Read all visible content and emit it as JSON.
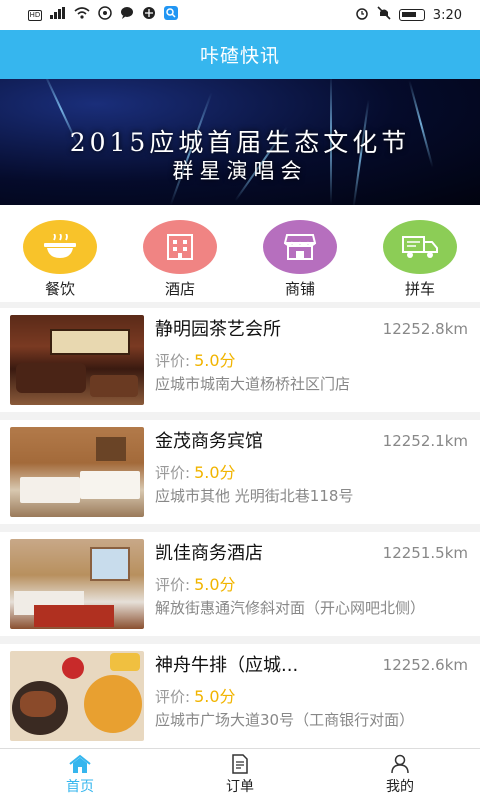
{
  "status": {
    "carrier": "HD",
    "signal": "4G",
    "time": "3:20"
  },
  "header": {
    "title": "咔碴快讯"
  },
  "banner": {
    "title": "2015应城首届生态文化节",
    "subtitle": "群星演唱会"
  },
  "categories": [
    {
      "label": "餐饮",
      "color": "#f8c32a",
      "icon": "food-bowl-icon"
    },
    {
      "label": "酒店",
      "color": "#f08483",
      "icon": "hotel-building-icon"
    },
    {
      "label": "商铺",
      "color": "#b66fbe",
      "icon": "shop-icon"
    },
    {
      "label": "拼车",
      "color": "#8ccd56",
      "icon": "truck-icon"
    }
  ],
  "listings": [
    {
      "name": "静明园茶艺会所",
      "distance": "12252.8km",
      "rating_label": "评价:",
      "score": "5.0分",
      "address": "应城市城南大道杨桥社区门店"
    },
    {
      "name": "金茂商务宾馆",
      "distance": "12252.1km",
      "rating_label": "评价:",
      "score": "5.0分",
      "address": "应城市其他 光明街北巷118号"
    },
    {
      "name": "凯佳商务酒店",
      "distance": "12251.5km",
      "rating_label": "评价:",
      "score": "5.0分",
      "address": "解放街惠通汽修斜对面（开心网吧北侧）"
    },
    {
      "name": "神舟牛排（应城...",
      "distance": "12252.6km",
      "rating_label": "评价:",
      "score": "5.0分",
      "address": "应城市广场大道30号（工商银行对面）"
    }
  ],
  "tabs": [
    {
      "label": "首页",
      "icon": "home-icon",
      "active": true
    },
    {
      "label": "订单",
      "icon": "order-icon",
      "active": false
    },
    {
      "label": "我的",
      "icon": "user-icon",
      "active": false
    }
  ],
  "colors": {
    "accent": "#36b6ee",
    "score": "#f1b400"
  }
}
